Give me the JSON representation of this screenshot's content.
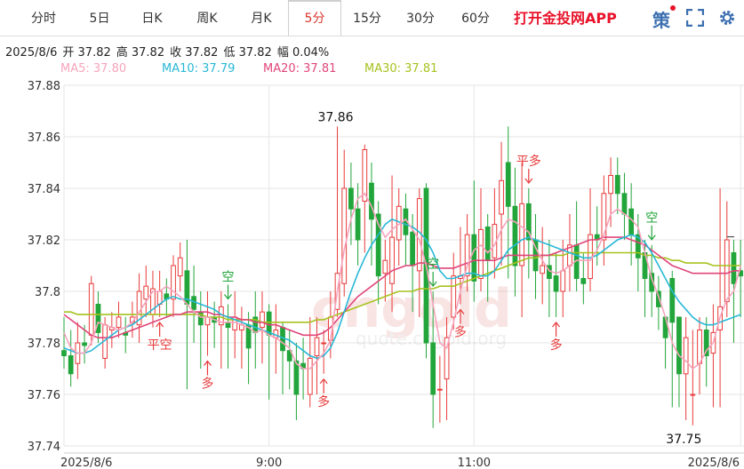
{
  "tabs": [
    {
      "label": "分时"
    },
    {
      "label": "5日"
    },
    {
      "label": "日K"
    },
    {
      "label": "周K"
    },
    {
      "label": "月K"
    },
    {
      "label": "5分"
    },
    {
      "label": "15分"
    },
    {
      "label": "30分"
    },
    {
      "label": "60分"
    }
  ],
  "active_tab": "5分",
  "promo": "打开金投网APP",
  "icons": {
    "strategy": "策",
    "fullscreen": "expand-icon"
  },
  "info": {
    "date": "2025/8/6",
    "open": "开 37.82",
    "high": "高 37.82",
    "close": "收 37.82",
    "low": "低 37.82",
    "range": "幅 0.04%"
  },
  "ma": {
    "ma5": "MA5: 37.80",
    "ma10": "MA10: 37.79",
    "ma20": "MA20: 37.81",
    "ma30": "MA30: 37.81"
  },
  "colors": {
    "up": "#e83a3a",
    "down": "#22a53a",
    "ma5": "#f6a4bd",
    "ma10": "#28b8d6",
    "ma20": "#e0457a",
    "ma30": "#a6c21e",
    "tab_active_text": "#d9342b",
    "promo": "#e8132a"
  },
  "chart_data": {
    "type": "candlestick",
    "ylim": [
      37.74,
      37.88
    ],
    "yticks": [
      "37.88",
      "37.86",
      "37.84",
      "37.82",
      "37.8",
      "37.78",
      "37.76",
      "37.74"
    ],
    "xticks": [
      {
        "label": "2025/8/6",
        "i": 0
      },
      {
        "label": "9:00",
        "i": 30
      },
      {
        "label": "11:00",
        "i": 60
      },
      {
        "label": "2025/8/6",
        "i": 99
      }
    ],
    "max_label": {
      "text": "37.86",
      "i": 40,
      "value": 37.864
    },
    "min_label": {
      "text": "37.75",
      "i": 92,
      "value": 37.748
    },
    "candles": [
      [
        37.777,
        37.775,
        37.79,
        37.77
      ],
      [
        37.775,
        37.768,
        37.785,
        37.763
      ],
      [
        37.772,
        37.78,
        37.788,
        37.766
      ],
      [
        37.78,
        37.779,
        37.787,
        37.772
      ],
      [
        37.783,
        37.803,
        37.806,
        37.779
      ],
      [
        37.795,
        37.784,
        37.8,
        37.78
      ],
      [
        37.774,
        37.787,
        37.79,
        37.77
      ],
      [
        37.785,
        37.786,
        37.792,
        37.778
      ],
      [
        37.786,
        37.79,
        37.796,
        37.782
      ],
      [
        37.784,
        37.783,
        37.79,
        37.776
      ],
      [
        37.788,
        37.79,
        37.796,
        37.782
      ],
      [
        37.787,
        37.8,
        37.807,
        37.78
      ],
      [
        37.797,
        37.802,
        37.81,
        37.79
      ],
      [
        37.791,
        37.801,
        37.808,
        37.786
      ],
      [
        37.795,
        37.8,
        37.808,
        37.79
      ],
      [
        37.799,
        37.797,
        37.805,
        37.79
      ],
      [
        37.797,
        37.81,
        37.814,
        37.79
      ],
      [
        37.806,
        37.813,
        37.819,
        37.8
      ],
      [
        37.808,
        37.795,
        37.82,
        37.762
      ],
      [
        37.798,
        37.793,
        37.81,
        37.78
      ],
      [
        37.792,
        37.787,
        37.8,
        37.77
      ],
      [
        37.787,
        37.79,
        37.8,
        37.775
      ],
      [
        37.79,
        37.788,
        37.796,
        37.778
      ],
      [
        37.787,
        37.794,
        37.8,
        37.77
      ],
      [
        37.788,
        37.786,
        37.795,
        37.77
      ],
      [
        37.785,
        37.79,
        37.8,
        37.774
      ],
      [
        37.785,
        37.787,
        37.794,
        37.77
      ],
      [
        37.787,
        37.778,
        37.792,
        37.764
      ],
      [
        37.79,
        37.784,
        37.8,
        37.77
      ],
      [
        37.786,
        37.792,
        37.8,
        37.772
      ],
      [
        37.792,
        37.783,
        37.795,
        37.758
      ],
      [
        37.782,
        37.785,
        37.795,
        37.768
      ],
      [
        37.786,
        37.777,
        37.788,
        37.76
      ],
      [
        37.777,
        37.773,
        37.785,
        37.762
      ],
      [
        37.773,
        37.76,
        37.78,
        37.75
      ],
      [
        37.772,
        37.77,
        37.782,
        37.758
      ],
      [
        37.76,
        37.774,
        37.79,
        37.755
      ],
      [
        37.775,
        37.782,
        37.79,
        37.76
      ],
      [
        37.78,
        37.78,
        37.785,
        37.768
      ],
      [
        37.781,
        37.79,
        37.8,
        37.774
      ],
      [
        37.793,
        37.807,
        37.864,
        37.79
      ],
      [
        37.803,
        37.84,
        37.855,
        37.798
      ],
      [
        37.84,
        37.832,
        37.85,
        37.818
      ],
      [
        37.832,
        37.82,
        37.842,
        37.81
      ],
      [
        37.835,
        37.855,
        37.857,
        37.815
      ],
      [
        37.842,
        37.828,
        37.85,
        37.81
      ],
      [
        37.83,
        37.806,
        37.835,
        37.795
      ],
      [
        37.807,
        37.812,
        37.82,
        37.796
      ],
      [
        37.803,
        37.821,
        37.845,
        37.792
      ],
      [
        37.82,
        37.833,
        37.84,
        37.81
      ],
      [
        37.832,
        37.822,
        37.838,
        37.81
      ],
      [
        37.823,
        37.81,
        37.83,
        37.792
      ],
      [
        37.808,
        37.836,
        37.84,
        37.79
      ],
      [
        37.84,
        37.78,
        37.842,
        37.774
      ],
      [
        37.78,
        37.76,
        37.8,
        37.747
      ],
      [
        37.762,
        37.762,
        37.775,
        37.749
      ],
      [
        37.766,
        37.782,
        37.79,
        37.75
      ],
      [
        37.79,
        37.806,
        37.815,
        37.785
      ],
      [
        37.805,
        37.806,
        37.825,
        37.795
      ],
      [
        37.806,
        37.822,
        37.83,
        37.8
      ],
      [
        37.822,
        37.804,
        37.843,
        37.796
      ],
      [
        37.805,
        37.824,
        37.84,
        37.8
      ],
      [
        37.825,
        37.812,
        37.83,
        37.796
      ],
      [
        37.813,
        37.826,
        37.84,
        37.805
      ],
      [
        37.83,
        37.843,
        37.858,
        37.81
      ],
      [
        37.85,
        37.833,
        37.864,
        37.805
      ],
      [
        37.833,
        37.81,
        37.848,
        37.798
      ],
      [
        37.81,
        37.834,
        37.85,
        37.79
      ],
      [
        37.834,
        37.82,
        37.84,
        37.805
      ],
      [
        37.82,
        37.808,
        37.83,
        37.797
      ],
      [
        37.807,
        37.81,
        37.825,
        37.795
      ],
      [
        37.81,
        37.805,
        37.82,
        37.79
      ],
      [
        37.806,
        37.8,
        37.815,
        37.79
      ],
      [
        37.8,
        37.808,
        37.82,
        37.79
      ],
      [
        37.81,
        37.818,
        37.83,
        37.8
      ],
      [
        37.818,
        37.805,
        37.835,
        37.8
      ],
      [
        37.805,
        37.803,
        37.815,
        37.795
      ],
      [
        37.805,
        37.822,
        37.84,
        37.8
      ],
      [
        37.822,
        37.82,
        37.833,
        37.81
      ],
      [
        37.82,
        37.838,
        37.845,
        37.81
      ],
      [
        37.838,
        37.845,
        37.852,
        37.825
      ],
      [
        37.845,
        37.838,
        37.852,
        37.83
      ],
      [
        37.838,
        37.83,
        37.846,
        37.82
      ],
      [
        37.832,
        37.822,
        37.842,
        37.81
      ],
      [
        37.822,
        37.813,
        37.83,
        37.8
      ],
      [
        37.815,
        37.805,
        37.82,
        37.79
      ],
      [
        37.807,
        37.8,
        37.818,
        37.79
      ],
      [
        37.8,
        37.794,
        37.806,
        37.785
      ],
      [
        37.79,
        37.782,
        37.79,
        37.77
      ],
      [
        37.805,
        37.788,
        37.808,
        37.755
      ],
      [
        37.79,
        37.768,
        37.79,
        37.755
      ],
      [
        37.768,
        37.782,
        37.79,
        37.75
      ],
      [
        37.76,
        37.76,
        37.785,
        37.748
      ],
      [
        37.772,
        37.785,
        37.79,
        37.76
      ],
      [
        37.785,
        37.775,
        37.79,
        37.763
      ],
      [
        37.776,
        37.784,
        37.795,
        37.755
      ],
      [
        37.785,
        37.794,
        37.84,
        37.755
      ],
      [
        37.796,
        37.82,
        37.835,
        37.79
      ],
      [
        37.815,
        37.803,
        37.82,
        37.78
      ],
      [
        37.808,
        37.806,
        37.82,
        37.79
      ]
    ],
    "ma5": [
      37.784,
      37.778,
      37.776,
      37.776,
      37.78,
      37.788,
      37.787,
      37.786,
      37.785,
      37.786,
      37.788,
      37.792,
      37.796,
      37.8,
      37.8,
      37.802,
      37.8,
      37.798,
      37.795,
      37.792,
      37.79,
      37.79,
      37.789,
      37.788,
      37.788,
      37.788,
      37.787,
      37.786,
      37.784,
      37.785,
      37.783,
      37.782,
      37.78,
      37.778,
      37.772,
      37.77,
      37.77,
      37.773,
      37.776,
      37.781,
      37.8,
      37.816,
      37.828,
      37.836,
      37.838,
      37.833,
      37.826,
      37.821,
      37.824,
      37.826,
      37.828,
      37.824,
      37.82,
      37.81,
      37.795,
      37.78,
      37.778,
      37.788,
      37.8,
      37.81,
      37.816,
      37.818,
      37.815,
      37.818,
      37.824,
      37.828,
      37.827,
      37.825,
      37.823,
      37.817,
      37.812,
      37.808,
      37.807,
      37.808,
      37.81,
      37.812,
      37.812,
      37.812,
      37.816,
      37.822,
      37.83,
      37.832,
      37.83,
      37.828,
      37.825,
      37.815,
      37.805,
      37.798,
      37.79,
      37.78,
      37.775,
      37.773,
      37.77,
      37.772,
      37.777,
      37.78,
      37.79,
      37.797,
      37.8,
      37.81
    ],
    "ma10": [
      37.778,
      37.777,
      37.776,
      37.776,
      37.777,
      37.779,
      37.781,
      37.783,
      37.785,
      37.786,
      37.787,
      37.789,
      37.791,
      37.793,
      37.795,
      37.797,
      37.798,
      37.797,
      37.797,
      37.796,
      37.795,
      37.794,
      37.793,
      37.791,
      37.79,
      37.789,
      37.788,
      37.787,
      37.786,
      37.785,
      37.784,
      37.783,
      37.782,
      37.781,
      37.779,
      37.777,
      37.775,
      37.774,
      37.775,
      37.778,
      37.784,
      37.792,
      37.8,
      37.807,
      37.813,
      37.818,
      37.822,
      37.826,
      37.828,
      37.827,
      37.826,
      37.825,
      37.823,
      37.82,
      37.815,
      37.808,
      37.805,
      37.805,
      37.806,
      37.807,
      37.807,
      37.806,
      37.806,
      37.808,
      37.812,
      37.816,
      37.818,
      37.82,
      37.821,
      37.82,
      37.819,
      37.818,
      37.817,
      37.816,
      37.815,
      37.814,
      37.813,
      37.813,
      37.814,
      37.816,
      37.818,
      37.82,
      37.821,
      37.822,
      37.821,
      37.819,
      37.815,
      37.81,
      37.805,
      37.8,
      37.796,
      37.793,
      37.79,
      37.788,
      37.787,
      37.787,
      37.788,
      37.789,
      37.79,
      37.791
    ],
    "ma20": [
      37.791,
      37.789,
      37.787,
      37.785,
      37.783,
      37.782,
      37.782,
      37.782,
      37.783,
      37.784,
      37.785,
      37.786,
      37.787,
      37.788,
      37.789,
      37.79,
      37.791,
      37.791,
      37.792,
      37.792,
      37.792,
      37.792,
      37.791,
      37.791,
      37.79,
      37.79,
      37.789,
      37.789,
      37.788,
      37.788,
      37.787,
      37.787,
      37.786,
      37.785,
      37.784,
      37.783,
      37.783,
      37.783,
      37.784,
      37.786,
      37.789,
      37.792,
      37.795,
      37.798,
      37.8,
      37.802,
      37.804,
      37.806,
      37.808,
      37.809,
      37.81,
      37.81,
      37.811,
      37.811,
      37.81,
      37.809,
      37.809,
      37.809,
      37.81,
      37.811,
      37.812,
      37.812,
      37.812,
      37.812,
      37.813,
      37.814,
      37.814,
      37.814,
      37.814,
      37.814,
      37.814,
      37.814,
      37.815,
      37.816,
      37.817,
      37.818,
      37.819,
      37.82,
      37.82,
      37.821,
      37.821,
      37.821,
      37.821,
      37.82,
      37.819,
      37.818,
      37.816,
      37.814,
      37.812,
      37.81,
      37.809,
      37.808,
      37.807,
      37.807,
      37.807,
      37.807,
      37.807,
      37.807,
      37.808,
      37.808
    ],
    "ma30": [
      37.792,
      37.792,
      37.791,
      37.791,
      37.791,
      37.791,
      37.791,
      37.791,
      37.791,
      37.791,
      37.791,
      37.791,
      37.791,
      37.791,
      37.791,
      37.791,
      37.791,
      37.791,
      37.791,
      37.791,
      37.791,
      37.79,
      37.79,
      37.79,
      37.789,
      37.789,
      37.789,
      37.789,
      37.789,
      37.788,
      37.788,
      37.788,
      37.788,
      37.788,
      37.788,
      37.788,
      37.788,
      37.789,
      37.789,
      37.79,
      37.791,
      37.792,
      37.793,
      37.794,
      37.795,
      37.796,
      37.797,
      37.798,
      37.799,
      37.8,
      37.8,
      37.8,
      37.801,
      37.801,
      37.801,
      37.802,
      37.802,
      37.802,
      37.803,
      37.804,
      37.805,
      37.806,
      37.807,
      37.808,
      37.809,
      37.81,
      37.811,
      37.812,
      37.813,
      37.813,
      37.814,
      37.814,
      37.814,
      37.814,
      37.815,
      37.815,
      37.815,
      37.815,
      37.815,
      37.815,
      37.815,
      37.815,
      37.815,
      37.815,
      37.815,
      37.814,
      37.814,
      37.813,
      37.813,
      37.812,
      37.812,
      37.811,
      37.811,
      37.811,
      37.811,
      37.81,
      37.81,
      37.81,
      37.81,
      37.81
    ],
    "signals": [
      {
        "i": 14,
        "text": "平空",
        "dir": "up"
      },
      {
        "i": 21,
        "text": "多",
        "dir": "up"
      },
      {
        "i": 24,
        "text": "空",
        "dir": "down"
      },
      {
        "i": 54,
        "text": "空",
        "dir": "down"
      },
      {
        "i": 38,
        "text": "多",
        "dir": "up"
      },
      {
        "i": 58,
        "text": "多",
        "dir": "up"
      },
      {
        "i": 68,
        "text": "平多",
        "dir": "down"
      },
      {
        "i": 72,
        "text": "多",
        "dir": "up"
      },
      {
        "i": 86,
        "text": "空",
        "dir": "down"
      }
    ]
  }
}
